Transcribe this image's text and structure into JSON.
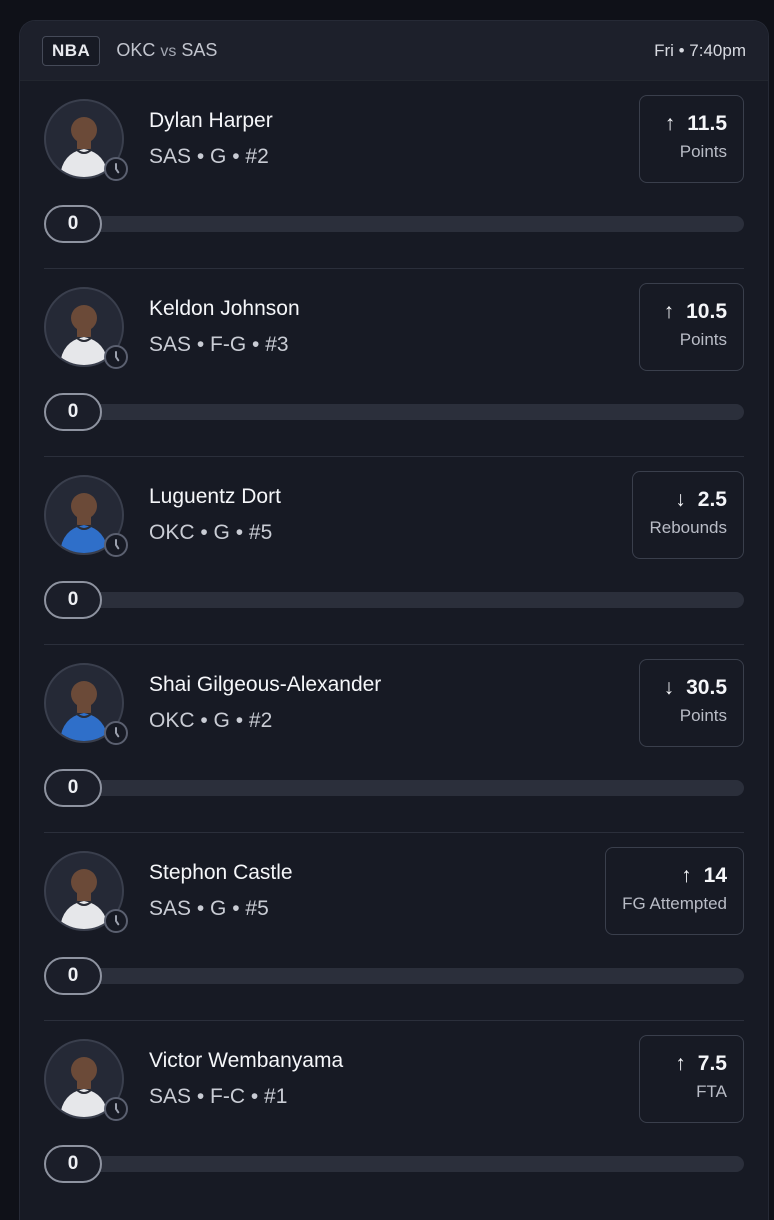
{
  "header": {
    "league": "NBA",
    "team_a": "OKC",
    "vs": "vs",
    "team_b": "SAS",
    "time": "Fri • 7:40pm"
  },
  "players": [
    {
      "name": "Dylan Harper",
      "meta": "SAS • G • #2",
      "direction": "up",
      "arrow": "↑",
      "line": "11.5",
      "stat": "Points",
      "current": "0",
      "jersey_color": "#e6e7ea"
    },
    {
      "name": "Keldon Johnson",
      "meta": "SAS • F-G • #3",
      "direction": "up",
      "arrow": "↑",
      "line": "10.5",
      "stat": "Points",
      "current": "0",
      "jersey_color": "#e6e7ea"
    },
    {
      "name": "Luguentz Dort",
      "meta": "OKC • G • #5",
      "direction": "down",
      "arrow": "↓",
      "line": "2.5",
      "stat": "Rebounds",
      "current": "0",
      "jersey_color": "#2f6fc9"
    },
    {
      "name": "Shai Gilgeous-Alexander",
      "meta": "OKC • G • #2",
      "direction": "down",
      "arrow": "↓",
      "line": "30.5",
      "stat": "Points",
      "current": "0",
      "jersey_color": "#2f6fc9"
    },
    {
      "name": "Stephon Castle",
      "meta": "SAS • G • #5",
      "direction": "up",
      "arrow": "↑",
      "line": "14",
      "stat": "FG Attempted",
      "current": "0",
      "jersey_color": "#e6e7ea"
    },
    {
      "name": "Victor Wembanyama",
      "meta": "SAS • F-C • #1",
      "direction": "up",
      "arrow": "↑",
      "line": "7.5",
      "stat": "FTA",
      "current": "0",
      "jersey_color": "#e6e7ea"
    }
  ],
  "icons": {
    "direction_up": "arrow-up-icon",
    "direction_down": "arrow-down-icon",
    "status": "clock-icon"
  },
  "colors": {
    "background": "#0f1118",
    "card": "#171a24",
    "header": "#1d202b",
    "track": "#2b2f3b",
    "text": "#f5f6f9"
  }
}
